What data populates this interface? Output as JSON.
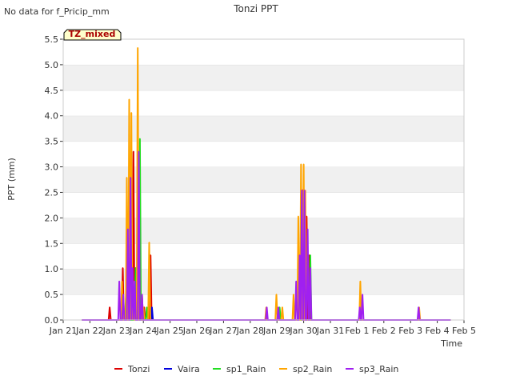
{
  "chart_data": {
    "type": "line",
    "title": "Tonzi PPT",
    "note": "No data for f_Pricip_mm",
    "badge": "TZ_mixed",
    "xlabel": "Time",
    "ylabel": "PPT (mm)",
    "ylim": [
      0,
      5.5
    ],
    "xlim": [
      0,
      15
    ],
    "y_ticks": [
      0.0,
      0.5,
      1.0,
      1.5,
      2.0,
      2.5,
      3.0,
      3.5,
      4.0,
      4.5,
      5.0,
      5.5
    ],
    "x_ticks": [
      {
        "v": 0,
        "label": "Jan 21"
      },
      {
        "v": 1,
        "label": "Jan 22"
      },
      {
        "v": 2,
        "label": "Jan 23"
      },
      {
        "v": 3,
        "label": "Jan 24"
      },
      {
        "v": 4,
        "label": "Jan 25"
      },
      {
        "v": 5,
        "label": "Jan 26"
      },
      {
        "v": 6,
        "label": "Jan 27"
      },
      {
        "v": 7,
        "label": "Jan 28"
      },
      {
        "v": 8,
        "label": "Jan 29"
      },
      {
        "v": 9,
        "label": "Jan 30"
      },
      {
        "v": 10,
        "label": "Jan 31"
      },
      {
        "v": 11,
        "label": "Feb 1"
      },
      {
        "v": 12,
        "label": "Feb 2"
      },
      {
        "v": 13,
        "label": "Feb 3"
      },
      {
        "v": 14,
        "label": "Feb 4"
      },
      {
        "v": 15,
        "label": "Feb 5"
      }
    ],
    "grid": "horizontal bands",
    "legend_position": "bottom",
    "x_start": 0.7,
    "x_end": 14.5,
    "series": [
      {
        "name": "Tonzi",
        "color": "#dd0000",
        "points": [
          [
            1.74,
            0.25
          ],
          [
            2.23,
            1.02
          ],
          [
            2.39,
            0.76
          ],
          [
            2.55,
            0.5
          ],
          [
            2.63,
            3.3
          ],
          [
            2.71,
            1.02
          ],
          [
            2.95,
            0.5
          ],
          [
            3.03,
            0.25
          ],
          [
            3.27,
            1.27
          ],
          [
            8.97,
            2.55
          ],
          [
            9.11,
            2.03
          ],
          [
            9.21,
            1.27
          ]
        ]
      },
      {
        "name": "Vaira",
        "color": "#0000dd",
        "points": [
          [
            2.6,
            0.5
          ],
          [
            3.32,
            0.25
          ],
          [
            8.95,
            1.02
          ]
        ]
      },
      {
        "name": "sp1_Rain",
        "color": "#22dd22",
        "points": [
          [
            2.35,
            0.5
          ],
          [
            2.45,
            0.25
          ],
          [
            2.71,
            1.02
          ],
          [
            2.87,
            3.55
          ],
          [
            3.13,
            0.25
          ],
          [
            8.1,
            0.25
          ],
          [
            8.95,
            0.5
          ],
          [
            9.25,
            1.27
          ]
        ]
      },
      {
        "name": "sp2_Rain",
        "color": "#ffa500",
        "points": [
          [
            2.2,
            0.76
          ],
          [
            2.38,
            2.79
          ],
          [
            2.47,
            4.32
          ],
          [
            2.55,
            4.06
          ],
          [
            2.63,
            0.76
          ],
          [
            2.79,
            5.33
          ],
          [
            3.0,
            0.25
          ],
          [
            3.22,
            1.52
          ],
          [
            7.6,
            0.25
          ],
          [
            7.98,
            0.5
          ],
          [
            8.2,
            0.25
          ],
          [
            8.62,
            0.5
          ],
          [
            8.8,
            2.03
          ],
          [
            8.9,
            3.05
          ],
          [
            9.0,
            3.05
          ],
          [
            9.06,
            2.54
          ],
          [
            11.12,
            0.76
          ],
          [
            13.32,
            0.25
          ]
        ]
      },
      {
        "name": "sp3_Rain",
        "color": "#a020f0",
        "points": [
          [
            2.1,
            0.76
          ],
          [
            2.25,
            0.5
          ],
          [
            2.42,
            1.78
          ],
          [
            2.52,
            2.79
          ],
          [
            2.6,
            1.02
          ],
          [
            2.68,
            0.76
          ],
          [
            2.83,
            3.3
          ],
          [
            2.95,
            0.5
          ],
          [
            7.62,
            0.25
          ],
          [
            8.05,
            0.25
          ],
          [
            8.72,
            0.76
          ],
          [
            8.85,
            1.27
          ],
          [
            8.93,
            2.54
          ],
          [
            9.03,
            2.54
          ],
          [
            9.15,
            1.78
          ],
          [
            9.25,
            1.02
          ],
          [
            11.1,
            0.25
          ],
          [
            11.2,
            0.5
          ],
          [
            13.3,
            0.25
          ]
        ]
      }
    ]
  }
}
